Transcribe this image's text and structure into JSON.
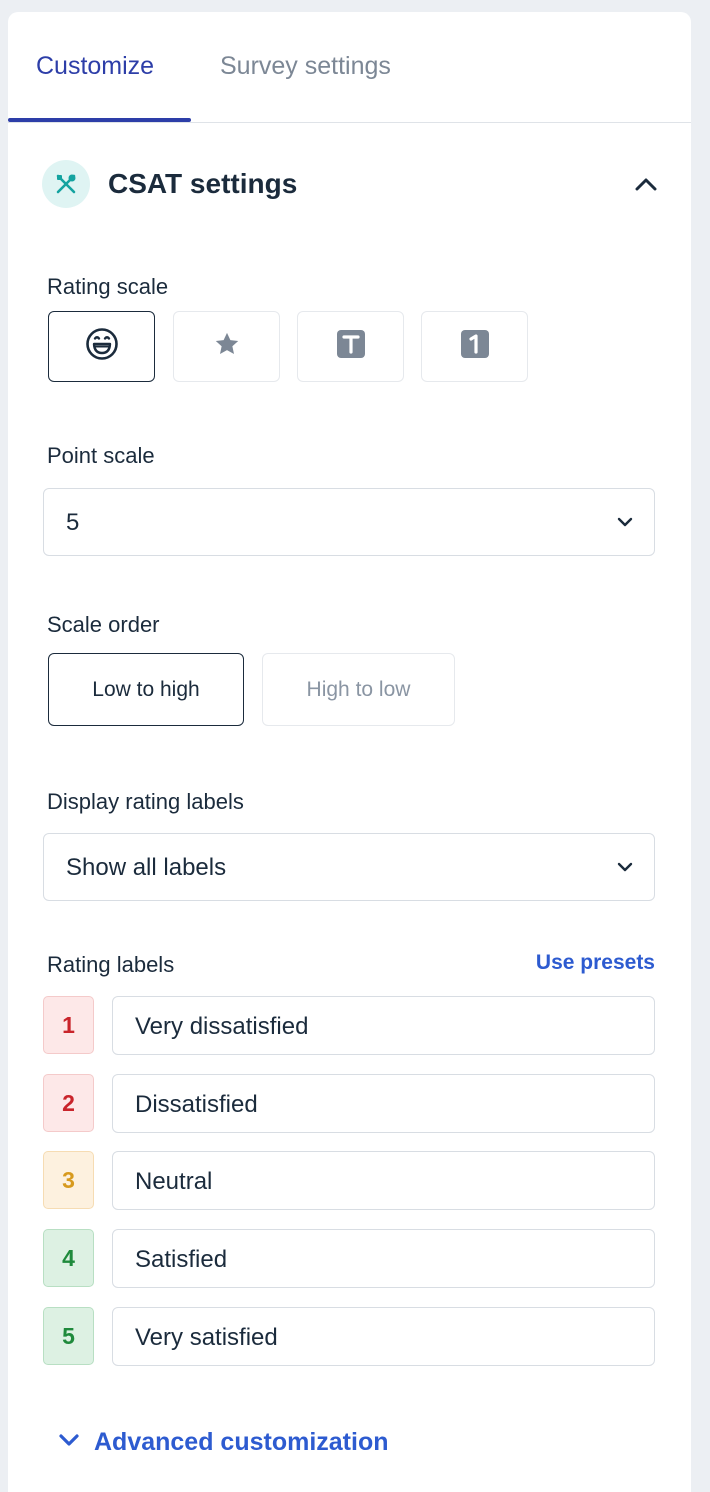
{
  "tabs": [
    {
      "label": "Customize",
      "active": true
    },
    {
      "label": "Survey settings",
      "active": false
    }
  ],
  "section": {
    "title": "CSAT settings",
    "icon": "tools-icon",
    "icon_color": "#14a3a0",
    "expanded": true
  },
  "rating_scale": {
    "label": "Rating scale",
    "options": [
      {
        "name": "emoji",
        "icon": "smiley-icon",
        "selected": true
      },
      {
        "name": "star",
        "icon": "star-icon",
        "selected": false
      },
      {
        "name": "text",
        "icon": "text-t-icon",
        "glyph": "T",
        "selected": false
      },
      {
        "name": "number",
        "icon": "number-one-icon",
        "glyph": "1",
        "selected": false
      }
    ]
  },
  "point_scale": {
    "label": "Point scale",
    "value": "5"
  },
  "scale_order": {
    "label": "Scale order",
    "options": [
      {
        "label": "Low to high",
        "selected": true
      },
      {
        "label": "High to low",
        "selected": false
      }
    ]
  },
  "display_labels": {
    "label": "Display rating labels",
    "value": "Show all labels"
  },
  "rating_labels": {
    "label": "Rating labels",
    "presets_link": "Use presets",
    "items": [
      {
        "num": "1",
        "text": "Very dissatisfied",
        "color": "#c9242b",
        "bg": "#fde8e8",
        "border": "#f4caca"
      },
      {
        "num": "2",
        "text": "Dissatisfied",
        "color": "#c9242b",
        "bg": "#fde8e8",
        "border": "#f4caca"
      },
      {
        "num": "3",
        "text": "Neutral",
        "color": "#d79a1e",
        "bg": "#fdf1df",
        "border": "#f6dcb3"
      },
      {
        "num": "4",
        "text": "Satisfied",
        "color": "#1f8a3c",
        "bg": "#ddf1e3",
        "border": "#b8dfc3"
      },
      {
        "num": "5",
        "text": "Very satisfied",
        "color": "#1f8a3c",
        "bg": "#ddf1e3",
        "border": "#b8dfc3"
      }
    ]
  },
  "advanced": {
    "label": "Advanced customization"
  },
  "colors": {
    "accent": "#2d3ea8",
    "link": "#2d5bd0",
    "text": "#1b2b3c",
    "muted": "#7c8795"
  }
}
